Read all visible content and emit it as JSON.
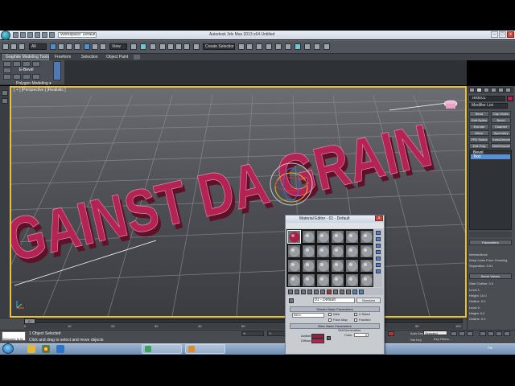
{
  "window": {
    "title": "Autodesk 3ds Max 2013 x64   Untitled",
    "workspace": "Workspace: Default",
    "min": "–",
    "max": "□",
    "close": "x"
  },
  "toolbar": {
    "selection_filter": "All",
    "ref_coord": "View",
    "named_selection": "Create Selection Set"
  },
  "ribbon": {
    "active_tab": "Graphite Modeling Tools",
    "tabs": [
      "Freeform",
      "Selection",
      "Object Paint"
    ],
    "edit_label": "E-Bevel",
    "footer": "Polygon Modeling ▾"
  },
  "viewport": {
    "label": "[ + ] [Perspective ] [Realistic ]",
    "scene_text": "GAINST DA GRAIN"
  },
  "command_panel": {
    "object_name": "Text001",
    "modifier_list": "Modifier List",
    "buttons": [
      "Bend",
      "Cap Holes",
      "Edit Spline",
      "Bevel",
      "Extrude",
      "Chamfer",
      "Mirror",
      "Symmetry",
      "FFD Select",
      "TurboSmooth",
      "Edit Poly",
      "ShellSmooth"
    ],
    "stack": [
      "Bevel",
      "Text"
    ],
    "rollouts": {
      "parameters": "Parameters",
      "bevel_values": "Bevel Values"
    },
    "rows": [
      "Intersections",
      "Keep Lines From Crossing",
      "Separation: 0.01",
      "Start Outline: 0.0",
      "Level 1:",
      "Height: 10.0",
      "Outline: 0.0",
      "Level 2:",
      "Height: 0.0",
      "Outline: 0.0"
    ]
  },
  "timeline": {
    "frame": "0 / 100",
    "ticks": [
      "0",
      "10",
      "20",
      "30",
      "40",
      "50",
      "60",
      "70",
      "80",
      "90",
      "100"
    ]
  },
  "status": {
    "objects": "1 Object Selected",
    "prompt": "Click and drag to select and move objects",
    "maxscript": "Welcome to M",
    "autokey": "Auto Key",
    "setkey": "Set Key",
    "selected": "Selected",
    "key_filters": "Key Filters...",
    "coord_x": "X:",
    "coord_y": "Y:",
    "coord_z": "Z:"
  },
  "taskbar": {
    "time": "PM"
  },
  "material_editor": {
    "title": "Material Editor - 01 - Default",
    "material_name": "01 - Default",
    "material_type": "Standard",
    "shader_rollout": "Shader Basic Parameters",
    "shader": "Blinn",
    "options": [
      "Wire",
      "2-Sided",
      "Face Map",
      "Faceted"
    ],
    "blinn_rollout": "Blinn Basic Parameters",
    "self_illum": "Self-Illumination",
    "color_label": "Color",
    "color_value": "0",
    "ambient_label": "Ambient:",
    "diffuse_label": "Diffuse:"
  },
  "colors": {
    "text_mesh": "#b32454",
    "viewport_border": "#e8c23a",
    "selection_highlight": "#5a8fd3"
  }
}
